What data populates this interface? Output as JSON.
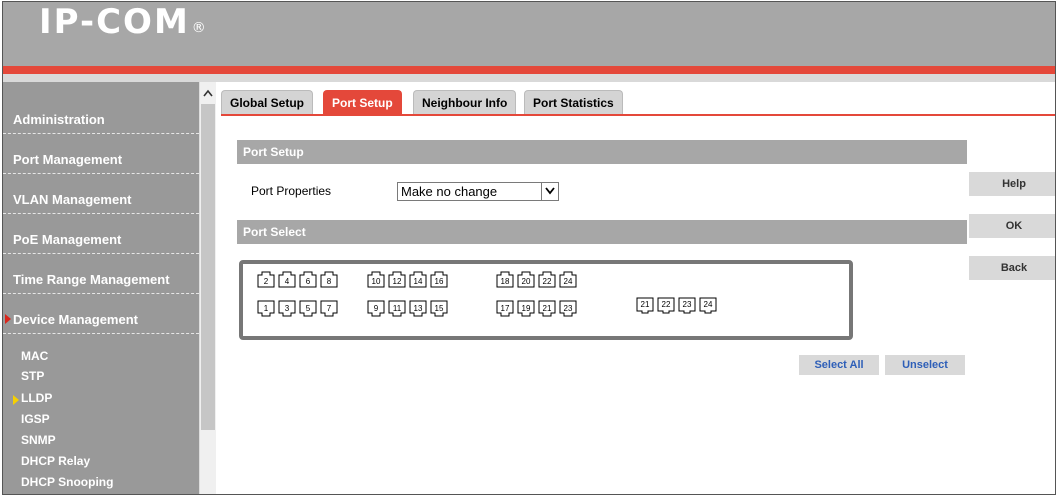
{
  "brand": {
    "logo": "IP-COM",
    "reg_mark": "®"
  },
  "sidebar": {
    "menu": [
      {
        "label": "Administration"
      },
      {
        "label": "Port Management"
      },
      {
        "label": "VLAN Management"
      },
      {
        "label": "PoE Management"
      },
      {
        "label": "Time Range Management"
      },
      {
        "label": "Device Management"
      }
    ],
    "submenu": [
      {
        "label": "MAC"
      },
      {
        "label": "STP"
      },
      {
        "label": "LLDP"
      },
      {
        "label": "IGSP"
      },
      {
        "label": "SNMP"
      },
      {
        "label": "DHCP Relay"
      },
      {
        "label": "DHCP Snooping"
      }
    ],
    "active_menu": "Device Management",
    "active_submenu": "LLDP"
  },
  "tabs": [
    {
      "label": "Global Setup"
    },
    {
      "label": "Port Setup"
    },
    {
      "label": "Neighbour Info"
    },
    {
      "label": "Port Statistics"
    }
  ],
  "active_tab": "Port Setup",
  "port_setup": {
    "title": "Port Setup",
    "properties_label": "Port Properties",
    "properties_value": "Make no change"
  },
  "port_select": {
    "title": "Port Select",
    "top_row": [
      "2",
      "4",
      "6",
      "8",
      "10",
      "12",
      "14",
      "16",
      "18",
      "20",
      "22",
      "24"
    ],
    "bottom_row": [
      "1",
      "3",
      "5",
      "7",
      "9",
      "11",
      "13",
      "15",
      "17",
      "19",
      "21",
      "23"
    ],
    "sfp_row": [
      "21",
      "22",
      "23",
      "24"
    ],
    "select_all": "Select All",
    "unselect": "Unselect"
  },
  "side_buttons": {
    "help": "Help",
    "ok": "OK",
    "back": "Back"
  },
  "colors": {
    "accent": "#e4483a",
    "header": "#a7a7a7",
    "sidebar": "#999999",
    "active_arrow": "#f5d000"
  }
}
